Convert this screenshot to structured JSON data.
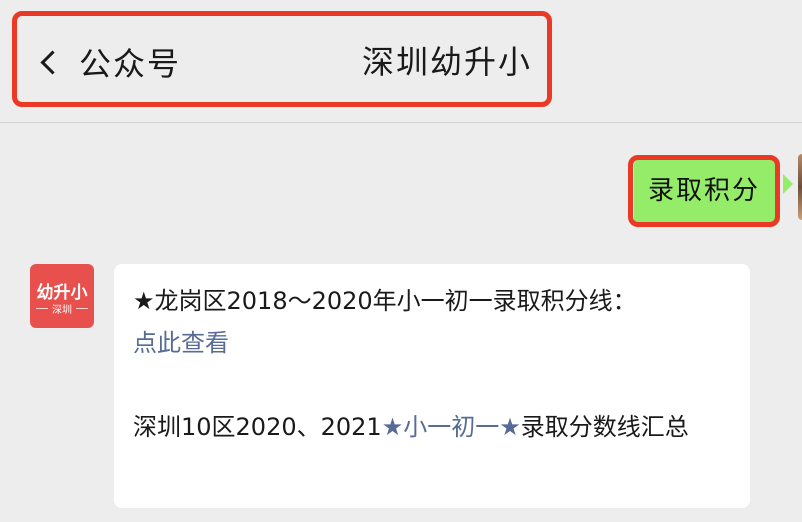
{
  "header": {
    "back_label": "公众号",
    "account_name": "深圳幼升小"
  },
  "user_message": {
    "text": "录取积分"
  },
  "oa_avatar": {
    "logo_text": "幼升小",
    "logo_sub": "深圳"
  },
  "reply": {
    "line1_star": "★",
    "line1_text": "龙岗区2018～2020年小一初一录取积分线：",
    "line1_link": "点此查看",
    "line2_prefix": "深圳10区2020、2021",
    "line2_star1": "★",
    "line2_link": "小一初一",
    "line2_star2": "★",
    "line2_suffix": "录取分数线汇总"
  },
  "colors": {
    "background": "#ededed",
    "highlight": "#ea3a25",
    "user_bubble": "#95ec69",
    "link": "#576b95",
    "avatar_red": "#e8504d"
  }
}
